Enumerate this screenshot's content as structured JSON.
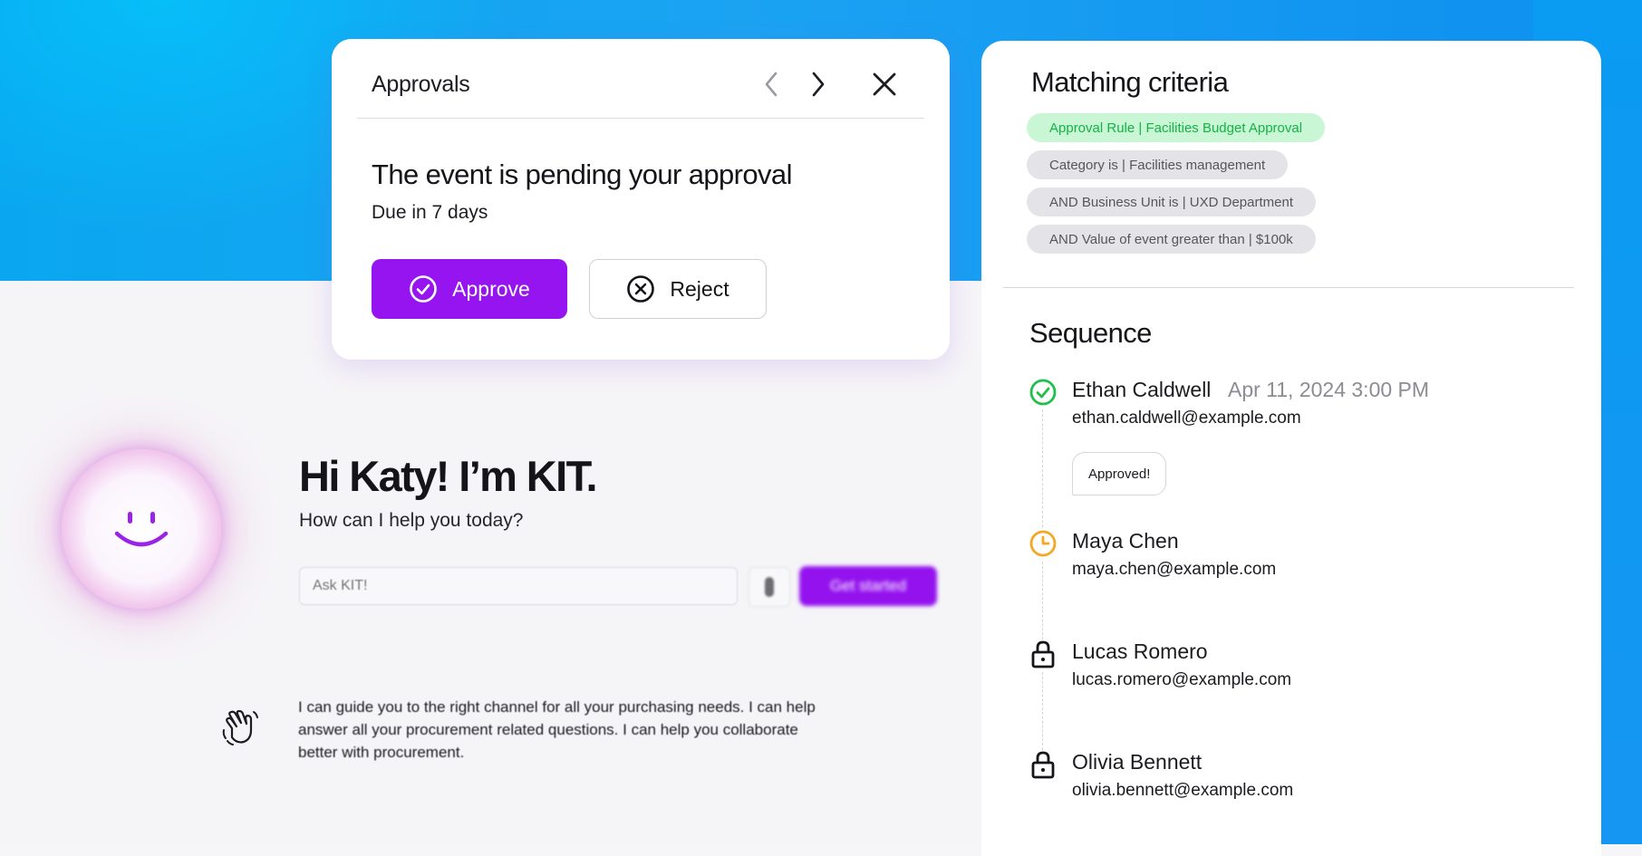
{
  "approvals": {
    "title": "Approvals",
    "pending_title": "The event is pending your approval",
    "due": "Due in 7 days",
    "approve_label": "Approve",
    "reject_label": "Reject"
  },
  "kit": {
    "title": "Hi Katy! I’m KIT.",
    "subtitle": "How can I help you today?",
    "input_placeholder": "Ask KIT!",
    "get_started_label": "Get started",
    "guide_text": "I can guide you to the right channel for all your purchasing needs. I can help answer all your procurement related questions. I can help you collaborate better with procurement."
  },
  "criteria": {
    "title": "Matching criteria",
    "chips": [
      {
        "label": "Approval Rule | Facilities Budget Approval",
        "style": "green"
      },
      {
        "label": "Category is | Facilities management",
        "style": "gray"
      },
      {
        "label": "AND Business Unit is | UXD Department",
        "style": "gray"
      },
      {
        "label": "AND Value of event greater than | $100k",
        "style": "gray"
      }
    ]
  },
  "sequence": {
    "title": "Sequence",
    "items": [
      {
        "name": "Ethan Caldwell",
        "date": "Apr 11, 2024 3:00 PM",
        "email": "ethan.caldwell@example.com",
        "status": "approved",
        "comment": "Approved!"
      },
      {
        "name": "Maya Chen",
        "email": "maya.chen@example.com",
        "status": "pending"
      },
      {
        "name": "Lucas Romero",
        "email": "lucas.romero@example.com",
        "status": "locked"
      },
      {
        "name": "Olivia Bennett",
        "email": "olivia.bennett@example.com",
        "status": "locked"
      }
    ]
  },
  "colors": {
    "accent": "#9614ef",
    "approved": "#1fbf4a",
    "pending": "#f5a623",
    "background_blue": "#0aa7f0"
  },
  "icons": {
    "prev": "chevron-left-icon",
    "next": "chevron-right-icon",
    "close": "close-icon",
    "approve": "check-circle-icon",
    "reject": "x-circle-icon",
    "attach": "paperclip-icon",
    "wave": "waving-hand-icon",
    "approved_status": "check-circle-icon",
    "pending_status": "clock-icon",
    "locked_status": "lock-icon"
  }
}
